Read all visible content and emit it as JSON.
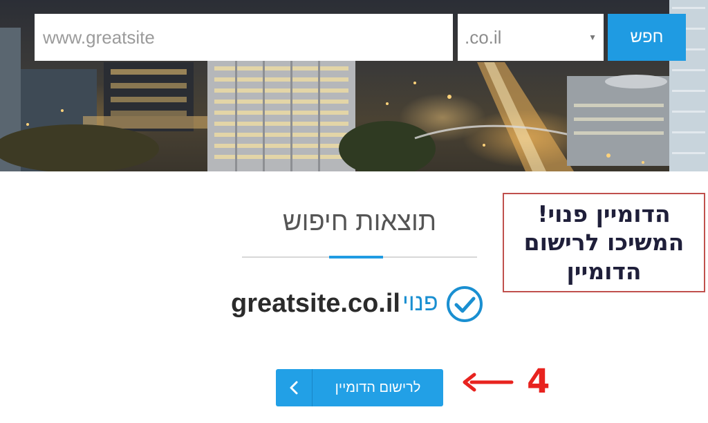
{
  "search": {
    "placeholder": "www.greatsite",
    "tld_selected": ".co.il",
    "button_label": "חפש"
  },
  "results": {
    "title": "תוצאות חיפוש",
    "domain": "greatsite.co.il",
    "status": "פנוי",
    "register_label": "לרישום הדומיין"
  },
  "annotation": {
    "lines": [
      "הדומיין פנוי!",
      "המשיכו לרישום",
      "הדומיין"
    ],
    "step_number": "4"
  },
  "icons": {
    "check": "check-circle-icon",
    "chevron": "chevron-left-icon",
    "arrow": "arrow-left-icon",
    "select_caret": "caret-down-icon"
  },
  "colors": {
    "accent": "#1f9be2",
    "status_text": "#1a8fd1",
    "annotation_border": "#c0504d",
    "annotation_arrow": "#e8231f"
  }
}
